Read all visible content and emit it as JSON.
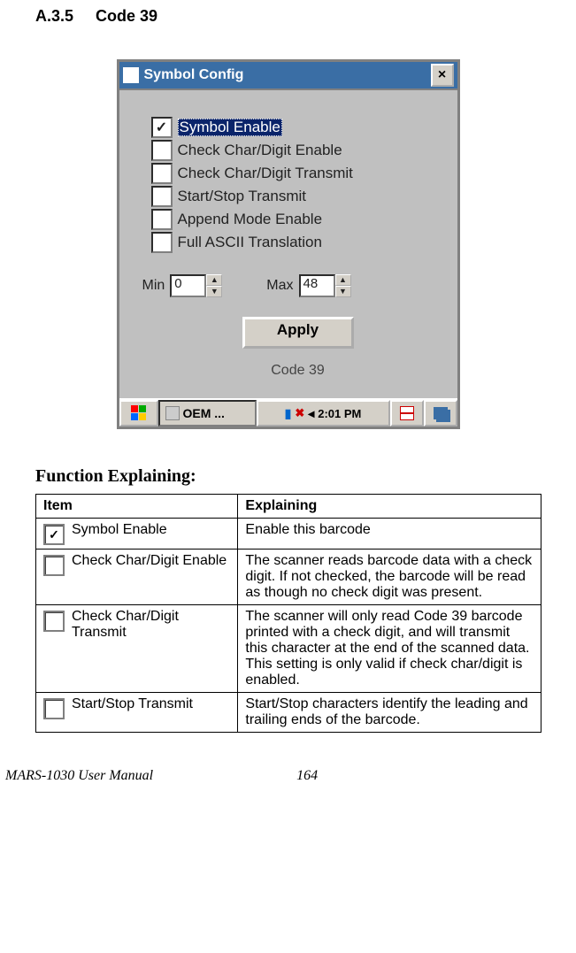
{
  "heading": {
    "number": "A.3.5",
    "title": "Code 39"
  },
  "window": {
    "title": "Symbol Config",
    "close_glyph": "×",
    "options": [
      {
        "label": "Symbol Enable",
        "checked": true,
        "selected": true
      },
      {
        "label": "Check Char/Digit Enable",
        "checked": false,
        "selected": false
      },
      {
        "label": "Check Char/Digit Transmit",
        "checked": false,
        "selected": false
      },
      {
        "label": "Start/Stop Transmit",
        "checked": false,
        "selected": false
      },
      {
        "label": "Append Mode Enable",
        "checked": false,
        "selected": false
      },
      {
        "label": "Full ASCII Translation",
        "checked": false,
        "selected": false
      }
    ],
    "min_label": "Min",
    "min_value": "0",
    "max_label": "Max",
    "max_value": "48",
    "apply_label": "Apply",
    "code_label": "Code 39"
  },
  "taskbar": {
    "app_label": "OEM ...",
    "time": "2:01 PM",
    "signal_glyph": "▮",
    "x_glyph": "✖",
    "speaker_glyph": "◂"
  },
  "section_title": "Function Explaining:",
  "table": {
    "header_item": "Item",
    "header_explain": "Explaining",
    "rows": [
      {
        "item": "Symbol Enable",
        "checked": true,
        "explain": "Enable this barcode"
      },
      {
        "item": "Check Char/Digit Enable",
        "checked": false,
        "explain": "The scanner reads barcode data with a check digit. If not checked, the barcode will be read as though no check digit was present."
      },
      {
        "item": "Check Char/Digit Transmit",
        "checked": false,
        "explain": "The scanner will only read Code 39 barcode printed with a check digit, and will transmit this character at the end of the scanned data. This setting is only valid if check char/digit is enabled."
      },
      {
        "item": "Start/Stop Transmit",
        "checked": false,
        "explain": "Start/Stop characters identify the leading and trailing ends of the barcode."
      }
    ]
  },
  "footer": {
    "manual": "MARS-1030 User Manual",
    "page": "164"
  }
}
